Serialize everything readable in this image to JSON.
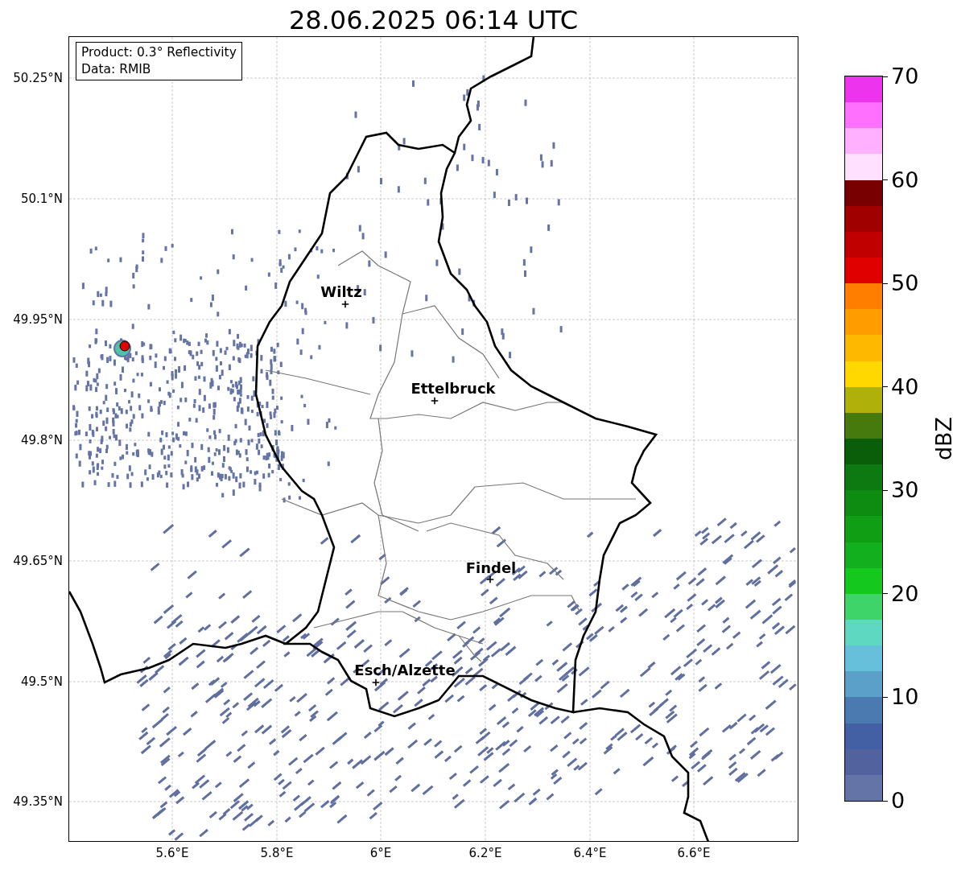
{
  "title": "28.06.2025 06:14 UTC",
  "info_box": {
    "lines": [
      "Product: 0.3° Reflectivity",
      "Data: RMIB"
    ]
  },
  "map": {
    "lat_labels": [
      "50.25°N",
      "50.1°N",
      "49.95°N",
      "49.8°N",
      "49.65°N",
      "49.5°N",
      "49.35°N"
    ],
    "lon_labels": [
      "5.6°E",
      "5.8°E",
      "6°E",
      "6.2°E",
      "6.4°E",
      "6.6°E"
    ],
    "cities": [
      {
        "name": "Wiltz"
      },
      {
        "name": "Ettelbruck"
      },
      {
        "name": "Findel"
      },
      {
        "name": "Esch/Alzette"
      }
    ]
  },
  "colorbar": {
    "label": "dBZ",
    "ticks": [
      "70",
      "60",
      "50",
      "40",
      "30",
      "20",
      "10",
      "0"
    ],
    "bins": [
      {
        "color": "#ee33ee"
      },
      {
        "color": "#ff70ff"
      },
      {
        "color": "#ffb0ff"
      },
      {
        "color": "#ffe0ff"
      },
      {
        "color": "#780000"
      },
      {
        "color": "#a00000"
      },
      {
        "color": "#c00000"
      },
      {
        "color": "#e00000"
      },
      {
        "color": "#ff7e00"
      },
      {
        "color": "#ff9c00"
      },
      {
        "color": "#ffb800"
      },
      {
        "color": "#ffd800"
      },
      {
        "color": "#b0b00a"
      },
      {
        "color": "#467a0c"
      },
      {
        "color": "#0a5e0a"
      },
      {
        "color": "#0c7a10"
      },
      {
        "color": "#0e8c12"
      },
      {
        "color": "#109e14"
      },
      {
        "color": "#12b01e"
      },
      {
        "color": "#14c81e"
      },
      {
        "color": "#3ed46a"
      },
      {
        "color": "#5ed8c0"
      },
      {
        "color": "#66c0dc"
      },
      {
        "color": "#5aa0c8"
      },
      {
        "color": "#4a7ab0"
      },
      {
        "color": "#4460a4"
      },
      {
        "color": "#52629e"
      },
      {
        "color": "#6474a6"
      }
    ]
  }
}
